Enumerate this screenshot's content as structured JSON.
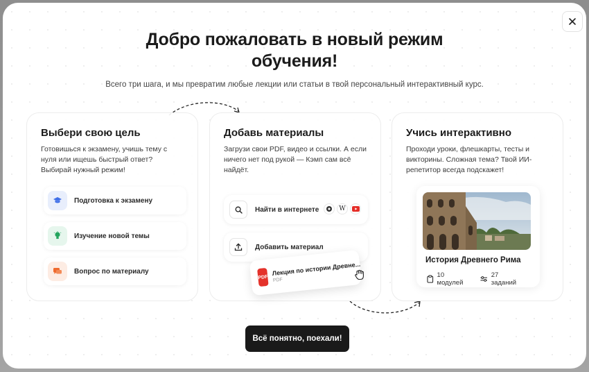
{
  "header": {
    "title_line1": "Добро пожаловать в новый режим",
    "title_line2": "обучения!",
    "subtitle": "Всего три шага, и мы превратим любые лекции или статьи в твой персональный интерактивный курс."
  },
  "close_icon": "close-icon",
  "steps": [
    {
      "title": "Выбери свою цель",
      "description": "Готовишься к экзамену, учишь тему с нуля или ищешь быстрый ответ? Выбирай нужный режим!",
      "options": [
        {
          "label": "Подготовка к экзамену",
          "icon": "graduation-cap-icon",
          "color": "#3f6fe8"
        },
        {
          "label": "Изучение новой темы",
          "icon": "lightbulb-icon",
          "color": "#25a55f"
        },
        {
          "label": "Вопрос по материалу",
          "icon": "chat-icon",
          "color": "#ef6a2d"
        }
      ]
    },
    {
      "title": "Добавь материалы",
      "description": "Загрузи свои PDF, видео и ссылки. А если ничего нет под рукой — Кэмп сам всё найдёт.",
      "actions": [
        {
          "label": "Найти в интернете",
          "icon": "search-icon"
        },
        {
          "label": "Добавить материал",
          "icon": "upload-icon"
        }
      ],
      "file": {
        "name": "Лекция по истории Древне...",
        "type": "PDF",
        "badge": "PDF"
      }
    },
    {
      "title": "Учись интерактивно",
      "description": "Проходи уроки, флешкарты, тесты и викторины. Сложная тема? Твой ИИ-репетитор всегда подскажет!",
      "course": {
        "title": "История Древнего Рима",
        "modules": "10 модулей",
        "tasks": "27 заданий"
      }
    }
  ],
  "cta_label": "Всё понятно, поехали!",
  "sources": {
    "wiki": "W"
  }
}
